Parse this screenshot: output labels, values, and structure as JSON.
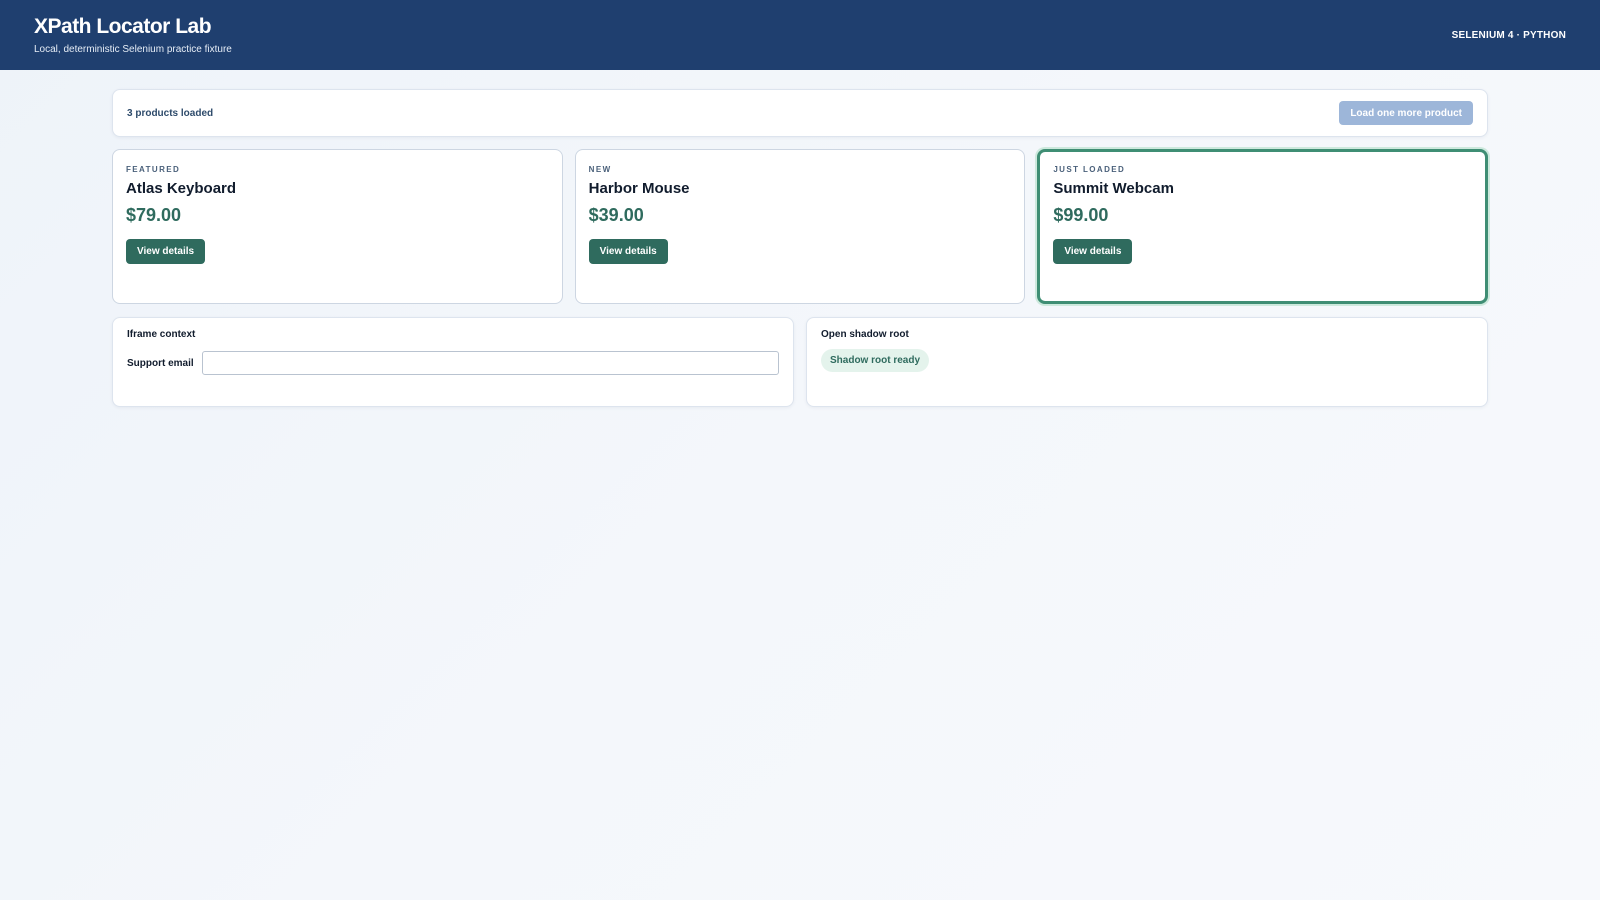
{
  "header": {
    "title": "XPath Locator Lab",
    "subtitle": "Local, deterministic Selenium practice fixture",
    "env_badge": "SELENIUM 4 · PYTHON",
    "background_color": "#1f3f6f"
  },
  "toolbar": {
    "count_label": "3 products loaded",
    "load_more_label": "Load one more product"
  },
  "products": [
    {
      "tag": "FEATURED",
      "name": "Atlas Keyboard",
      "price": "$79.00",
      "button_label": "View details"
    },
    {
      "tag": "NEW",
      "name": "Harbor Mouse",
      "price": "$39.00",
      "button_label": "View details"
    },
    {
      "tag": "JUST LOADED",
      "name": "Summit Webcam",
      "price": "$99.00",
      "button_label": "View details"
    }
  ],
  "iframe_panel": {
    "title": "Iframe context",
    "field_label": "Support email",
    "field_value": "",
    "field_placeholder": ""
  },
  "shadow_panel": {
    "title": "Open shadow root",
    "status_chip": "Shadow root ready"
  },
  "colors": {
    "accent_green": "#2f6b5e",
    "highlight_border": "#3f8e74",
    "disabled_button": "#9db6d9"
  }
}
